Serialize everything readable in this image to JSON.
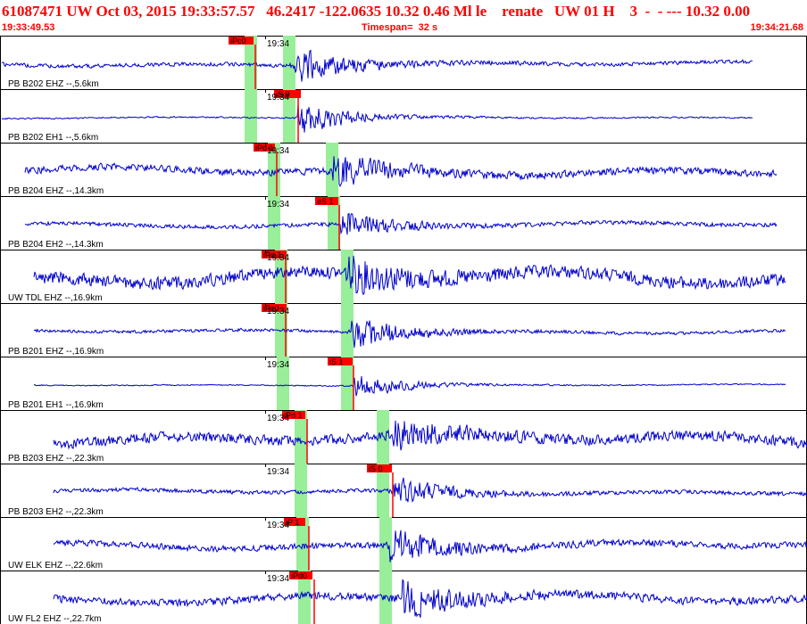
{
  "header": {
    "title": "61087471 UW Oct 03, 2015 19:33:57.57   46.2417 -122.0635 10.32 0.46 Ml le    renate   UW 01 H    3  -  - --- 10.32 0.00",
    "start_time": "19:33:49.53",
    "timespan": "Timespan=  32 s",
    "end_time": "19:34:21.68"
  },
  "colors": {
    "header_text": "#ff0000",
    "trace": "#0000cc",
    "pick_flag": "#ff0000",
    "pick_window": "#99ee99",
    "panel_border": "#000000"
  },
  "time_tick_label": "19:34",
  "channels": [
    {
      "label": "PB B202 EHZ --,5.6km",
      "pick": "iPc0",
      "tick": "19:34"
    },
    {
      "label": "PB B202 EH1 --,5.6km",
      "pick": "iS 0",
      "tick": "19:34"
    },
    {
      "label": "PB B204 EHZ --,14.3km",
      "pick": "iPd 1",
      "tick": "19:34"
    },
    {
      "label": "PB B204 EH2 --,14.3km",
      "pick": "eS 1",
      "tick": "19:34"
    },
    {
      "label": "UW TDL EHZ --,16.9km",
      "pick": "iPd 1",
      "tick": "19:34"
    },
    {
      "label": "PB B201 EHZ --,16.9km",
      "pick": "iPc0",
      "tick": "19:34"
    },
    {
      "label": "PB B201 EH1 --,16.9km",
      "pick": "iS 1",
      "tick": "19:34"
    },
    {
      "label": "PB B203 EHZ --,22.3km",
      "pick": "iPd 1",
      "tick": "19:34"
    },
    {
      "label": "PB B203 EH2 --,22.3km",
      "pick": "iS 0",
      "tick": "19:34"
    },
    {
      "label": "UW ELK EHZ --,22.6km",
      "pick": "iP 1",
      "tick": "19:34"
    },
    {
      "label": "UW FL2 EHZ --,22.7km",
      "pick": "iPd0",
      "tick": "19:34"
    }
  ]
}
